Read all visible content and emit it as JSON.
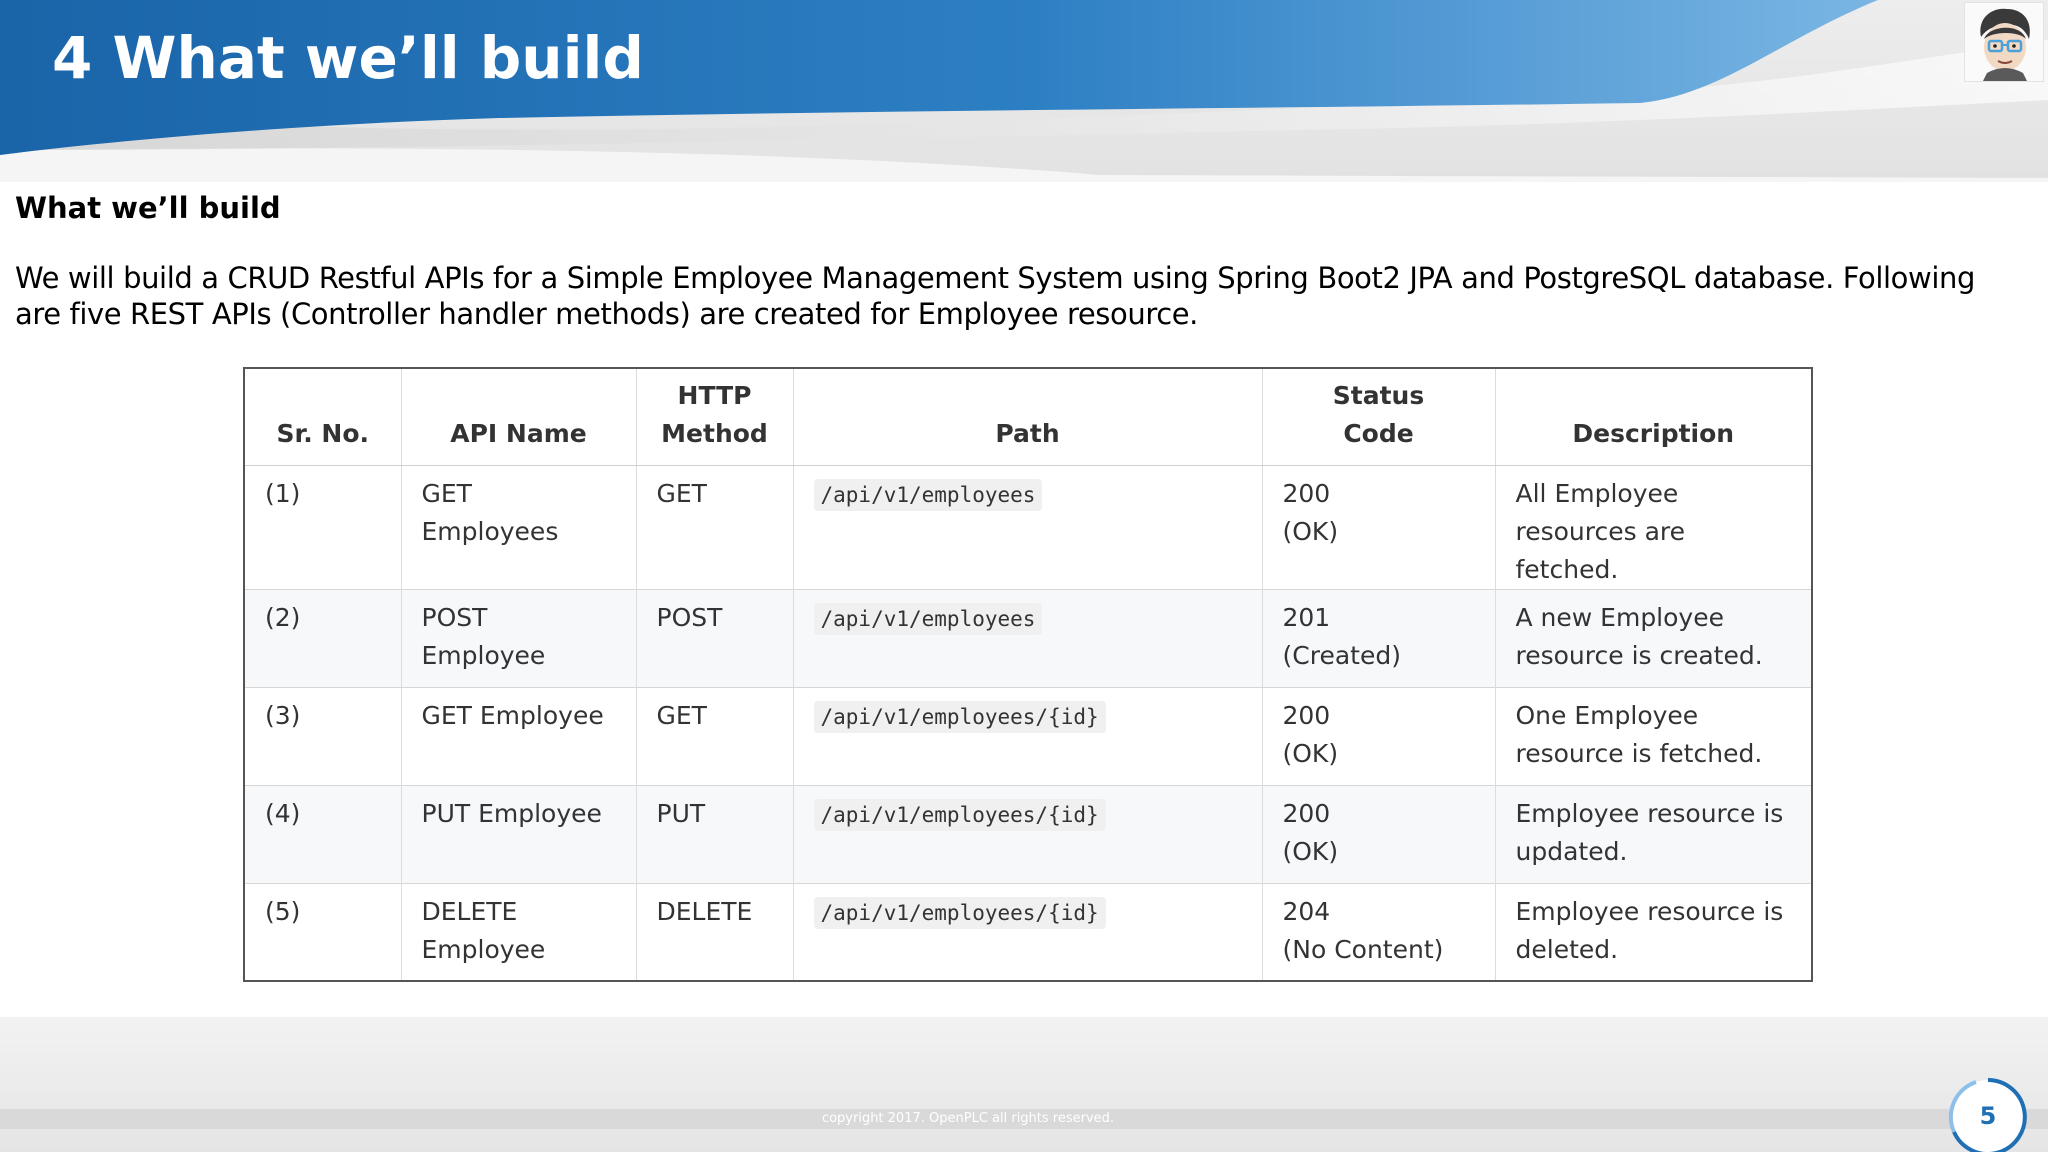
{
  "slide": {
    "title": "4 What we’ll build",
    "page_number": "5",
    "copyright": "copyright 2017. OpenPLC all rights reserved."
  },
  "content": {
    "heading": "What we’ll build",
    "intro": "We will build a CRUD Restful APIs for a Simple Employee Management System using Spring Boot2 JPA and PostgreSQL database. Following are five REST APIs (Controller handler methods) are created for Employee resource."
  },
  "table": {
    "headers": {
      "sr_no": "Sr. No.",
      "api_name": "API Name",
      "http_method_line1": "HTTP",
      "http_method_line2": "Method",
      "path": "Path",
      "status_line1": "Status",
      "status_line2": "Code",
      "description": "Description"
    },
    "rows": [
      {
        "sr_no": "(1)",
        "api_name": "GET Employees",
        "method": "GET",
        "path": "/api/v1/employees",
        "status_code": "200",
        "status_text": "(OK)",
        "description": "All Employee resources are fetched."
      },
      {
        "sr_no": "(2)",
        "api_name": "POST Employee",
        "method": "POST",
        "path": "/api/v1/employees",
        "status_code": "201",
        "status_text": "(Created)",
        "description": "A new Employee resource is created."
      },
      {
        "sr_no": "(3)",
        "api_name": "GET Employee",
        "method": "GET",
        "path": "/api/v1/employees/{id}",
        "status_code": "200",
        "status_text": "(OK)",
        "description": "One Employee resource is fetched."
      },
      {
        "sr_no": "(4)",
        "api_name": "PUT Employee",
        "method": "PUT",
        "path": "/api/v1/employees/{id}",
        "status_code": "200",
        "status_text": "(OK)",
        "description": "Employee resource is updated."
      },
      {
        "sr_no": "(5)",
        "api_name": "DELETE Employee",
        "method": "DELETE",
        "path": "/api/v1/employees/{id}",
        "status_code": "204",
        "status_text": "(No Content)",
        "description": "Employee resource is deleted."
      }
    ]
  },
  "colors": {
    "header_blue_dark": "#1a64a8",
    "header_blue_light": "#6aaee0",
    "page_number_blue": "#1f6fb5"
  },
  "icons": {
    "avatar": "cartoon-face-icon",
    "page_indicator": "circle-ring-icon"
  }
}
